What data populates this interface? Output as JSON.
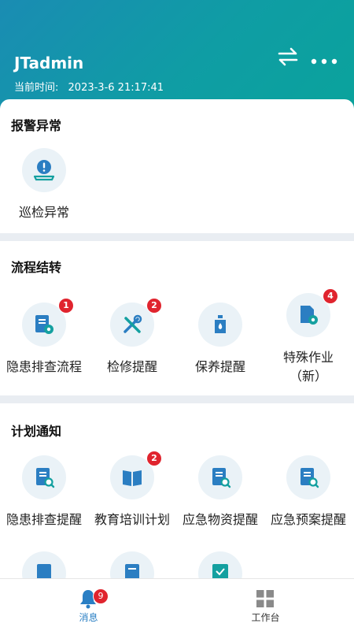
{
  "header": {
    "title": "JTadmin",
    "time_label": "当前时间:",
    "time_value": "2023-3-6 21:17:41"
  },
  "sections": {
    "alarm": {
      "title": "报警异常",
      "items": [
        {
          "label": "巡检异常",
          "icon": "inspection-alert-icon"
        }
      ]
    },
    "flow": {
      "title": "流程结转",
      "items": [
        {
          "label": "隐患排查流程",
          "badge": "1",
          "icon": "document-gear-icon"
        },
        {
          "label": "检修提醒",
          "badge": "2",
          "icon": "tools-icon"
        },
        {
          "label": "保养提醒",
          "icon": "oil-bottle-icon"
        },
        {
          "label": "特殊作业",
          "label2": "（新）",
          "badge": "4",
          "icon": "file-gear-icon"
        }
      ]
    },
    "plan": {
      "title": "计划通知",
      "items": [
        {
          "label": "隐患排查提醒",
          "icon": "document-search-icon"
        },
        {
          "label": "教育培训计划",
          "badge": "2",
          "icon": "book-icon"
        },
        {
          "label": "应急物资提醒",
          "icon": "document-search-icon"
        },
        {
          "label": "应急预案提醒",
          "icon": "document-search-icon"
        }
      ]
    }
  },
  "tabbar": {
    "messages": {
      "label": "消息",
      "badge": "9"
    },
    "workbench": {
      "label": "工作台"
    }
  },
  "colors": {
    "accent": "#2a7fc4",
    "icon_blue": "#2b7ec2",
    "icon_teal": "#14a0a0",
    "badge": "#e0242e"
  }
}
